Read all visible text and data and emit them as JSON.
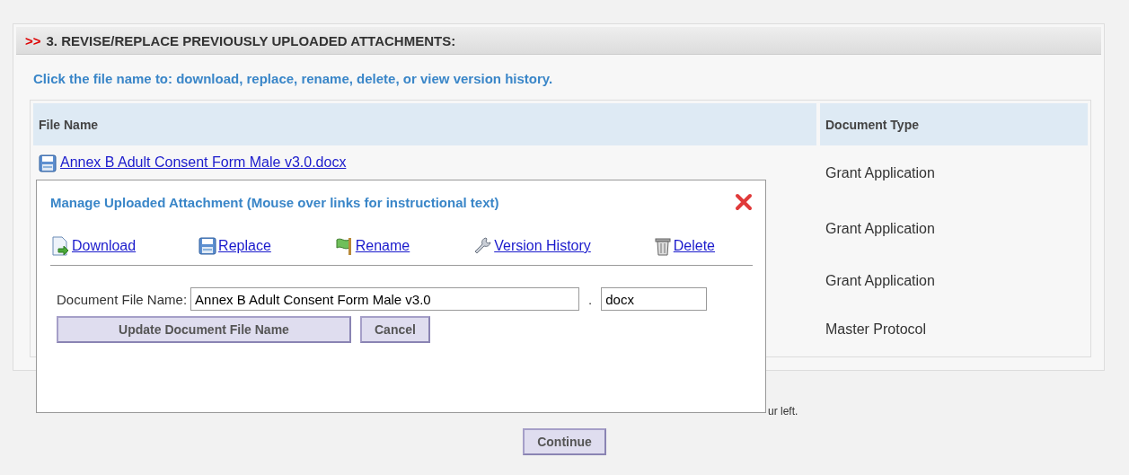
{
  "section": {
    "marker": ">>",
    "title": "3. REVISE/REPLACE PREVIOUSLY UPLOADED ATTACHMENTS:",
    "instruction": "Click the file name to: download, replace, rename, delete, or view version history."
  },
  "table": {
    "columns": [
      "File Name",
      "Document Type"
    ],
    "rows": [
      {
        "file": "Annex B Adult Consent Form Male v3.0.docx",
        "type": "Grant Application"
      },
      {
        "type": "Grant Application"
      },
      {
        "type": "Grant Application"
      },
      {
        "type": "Master Protocol"
      }
    ]
  },
  "note": "ur left.",
  "continue_button": "Continue",
  "dialog": {
    "title": "Manage Uploaded Attachment (Mouse over links for instructional text)",
    "actions": [
      {
        "kind": "download",
        "label": "Download"
      },
      {
        "kind": "replace",
        "label": "Replace"
      },
      {
        "kind": "rename",
        "label": "Rename"
      },
      {
        "kind": "history",
        "label": "Version History"
      },
      {
        "kind": "delete",
        "label": "Delete"
      }
    ],
    "field_label": "Document File Name:",
    "name_value": "Annex B Adult Consent Form Male v3.0",
    "separator": ".",
    "extension_value": "docx",
    "buttons": [
      "Update Document File Name",
      "Cancel"
    ]
  }
}
